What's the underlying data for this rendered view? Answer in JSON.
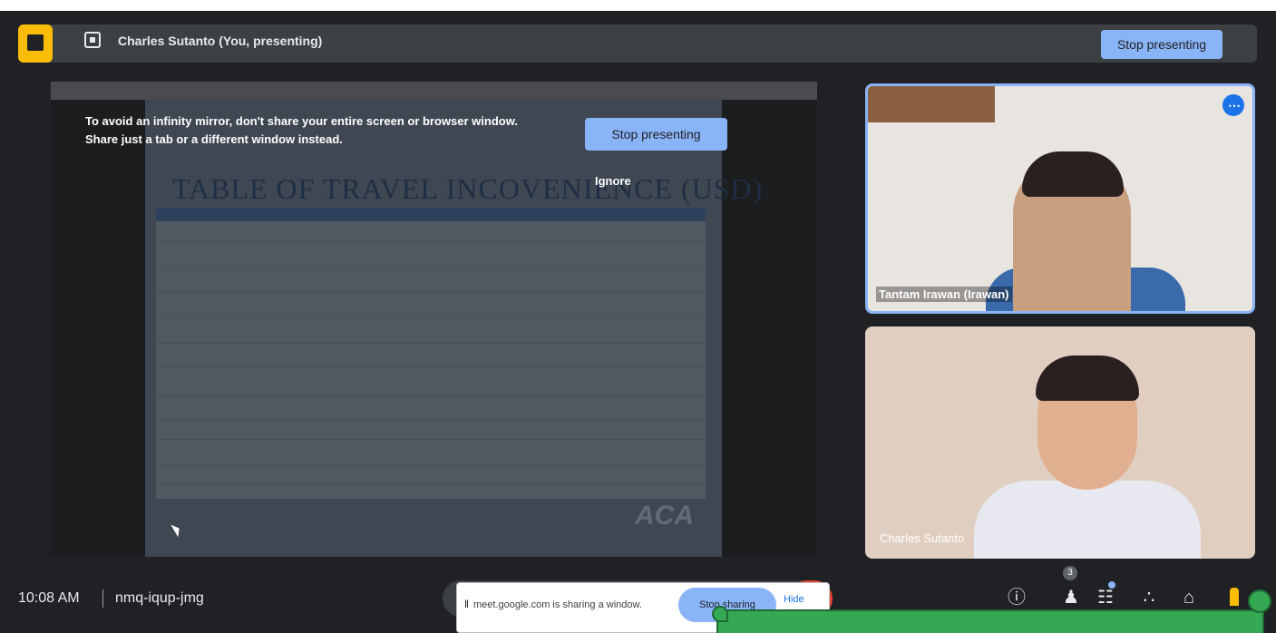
{
  "header": {
    "presenter_label": "Charles Sutanto (You, presenting)",
    "stop_presenting": "Stop presenting"
  },
  "share_warning": {
    "message": "To avoid an infinity mirror, don't share your entire screen or browser window. Share just a tab or a different window instead.",
    "stop_presenting": "Stop presenting",
    "ignore": "Ignore"
  },
  "slide": {
    "title": "TABLE OF TRAVEL INCOVENIENCE (USD)",
    "logo": "ACA"
  },
  "participants": [
    {
      "name": "Tantam Irawan (Irawan)",
      "more_label": "⋯"
    },
    {
      "name": "Charles Sutanto"
    }
  ],
  "footer": {
    "time": "10:08 AM",
    "meeting_code": "nmq-iqup-jmg",
    "participant_count": "3"
  },
  "sharing_bar": {
    "pause_icon": "‖",
    "message": "meet.google.com is sharing a window.",
    "stop_sharing": "Stop sharing",
    "hide": "Hide"
  },
  "icons": {
    "info": "ⓘ",
    "people": "♟",
    "chat": "☷",
    "activities": "∴",
    "lock": "⌂"
  },
  "colors": {
    "accent": "#8ab4f8",
    "present_badge": "#fbbc04",
    "end_call": "#ea4335"
  }
}
